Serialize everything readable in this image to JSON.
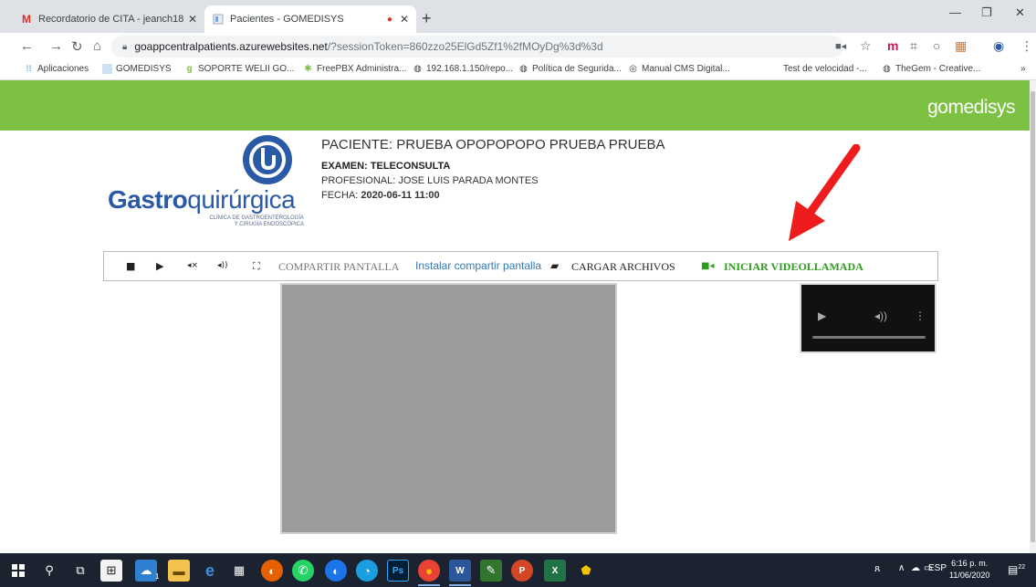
{
  "browser": {
    "tabs": [
      {
        "title": "Recordatorio de CITA - jeanch18",
        "favicon": "gmail-icon"
      },
      {
        "title": "Pacientes - GOMEDISYS",
        "favicon": "gomedisys-favicon",
        "recording": true
      }
    ],
    "new_tab_symbol": "+",
    "url_host": "goappcentralpatients.azurewebsites.net",
    "url_path": "/?sessionToken=860zzo25ElGd5Zf1%2fMOyDg%3d%3d",
    "bookmarks": [
      "Aplicaciones",
      "GOMEDISYS",
      "SOPORTE WELII GO...",
      "FreePBX Administra...",
      "192.168.1.150/repo...",
      "Política de Segurida...",
      "Manual CMS Digital...",
      "Test de velocidad -...",
      "TheGem - Creative..."
    ],
    "bookmarks_more": "»"
  },
  "page": {
    "brand": "gomedisys",
    "logo": {
      "name_bold": "Gastro",
      "name_rest": "quirúrgica",
      "sub_line1": "CLÍNICA DE GASTROENTEROLOGÍA",
      "sub_line2": "Y CIRUGÍA ENDOSCÓPICA"
    },
    "patient_line": "PACIENTE: PRUEBA OPOPOPOPO PRUEBA PRUEBA",
    "exam_line": "EXAMEN: TELECONSULTA",
    "professional_line": "PROFESIONAL: JOSE LUIS PARADA MONTES",
    "date_label": "FECHA:",
    "date_value": "2020-06-11 11:00",
    "controls": {
      "share_screen": "COMPARTIR  PANTALLA",
      "install_share": "Instalar compartir pantalla",
      "upload_files": "CARGAR  ARCHIVOS",
      "start_call": "INICIAR  VIDEOLLAMADA"
    },
    "colors": {
      "header_green": "#7dc142",
      "logo_blue": "#2a5aa6",
      "call_green": "#2e9a1e",
      "arrow_red": "#ee1c1c"
    }
  },
  "taskbar": {
    "language": "ESP",
    "time": "6:16 p. m.",
    "date": "11/06/2020",
    "notifications": "22",
    "badge": "1"
  }
}
